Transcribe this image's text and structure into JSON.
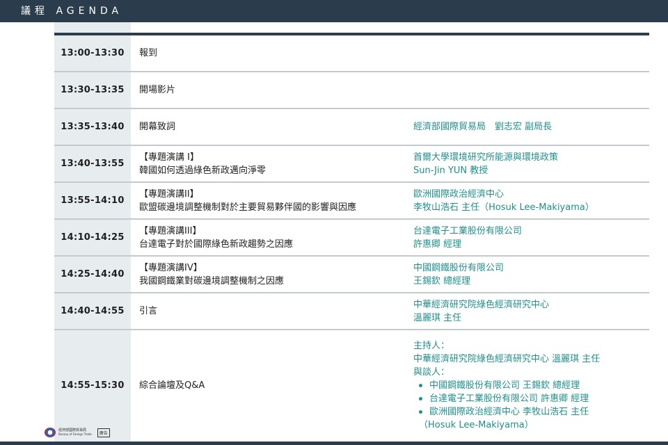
{
  "header": {
    "title": "議程 AGENDA"
  },
  "agenda": [
    {
      "time": "13:00-13:30",
      "topic": [
        "報到"
      ],
      "speaker": []
    },
    {
      "time": "13:30-13:35",
      "topic": [
        "開場影片"
      ],
      "speaker": []
    },
    {
      "time": "13:35-13:40",
      "topic": [
        "開幕致詞"
      ],
      "speaker": [
        "經濟部國際貿易局　劉志宏 副局長"
      ]
    },
    {
      "time": "13:40-13:55",
      "topic": [
        "【專題演講 I】",
        "韓國如何透過綠色新政邁向淨零"
      ],
      "speaker": [
        "首爾大學環境研究所能源與環境政策",
        "Sun-Jin YUN 教授"
      ]
    },
    {
      "time": "13:55-14:10",
      "topic": [
        "【專題演講II】",
        "歐盟碳邊境調整機制對於主要貿易夥伴國的影響與因應"
      ],
      "speaker": [
        "歐洲國際政治經濟中心",
        "李牧山浩石 主任（Hosuk Lee-Makiyama）"
      ]
    },
    {
      "time": "14:10-14:25",
      "topic": [
        "【專題演講III】",
        "台達電子對於國際綠色新政趨勢之因應"
      ],
      "speaker": [
        "台達電子工業股份有限公司",
        "許惠卿 經理"
      ]
    },
    {
      "time": "14:25-14:40",
      "topic": [
        "【專題演講IV】",
        "我國鋼鐵業對碳邊境調整機制之因應"
      ],
      "speaker": [
        "中國鋼鐵股份有限公司",
        "王錫欽 總經理"
      ]
    },
    {
      "time": "14:40-14:55",
      "topic": [
        "引言"
      ],
      "speaker": [
        "中華經濟研究院綠色經濟研究中心",
        "溫麗琪 主任"
      ]
    }
  ],
  "panel": {
    "time": "14:55-15:30",
    "topic": "綜合論壇及Q&A",
    "host_label": "主持人：",
    "host": "中華經濟研究院綠色經濟研究中心 溫麗琪 主任",
    "panelists_label": "與談人：",
    "panelists": [
      "中國鋼鐵股份有限公司 王錫欽 總經理",
      "台達電子工業股份有限公司 許惠卿 經理",
      "歐洲國際政治經濟中心 李牧山浩石 主任"
    ],
    "panelist_note": "（Hosuk Lee-Makiyama）"
  },
  "footer": {
    "logo_icon": "bureau-seal-icon",
    "org_zh": "經濟部國際貿易局",
    "org_en": "Bureau of Foreign Trade",
    "ad_label": "廣告"
  },
  "colors": {
    "header_bg": "#2b3d4c",
    "time_col_bg": "#e7ecee",
    "speaker_text": "#1f8f8e",
    "divider": "#c3c9cd"
  }
}
